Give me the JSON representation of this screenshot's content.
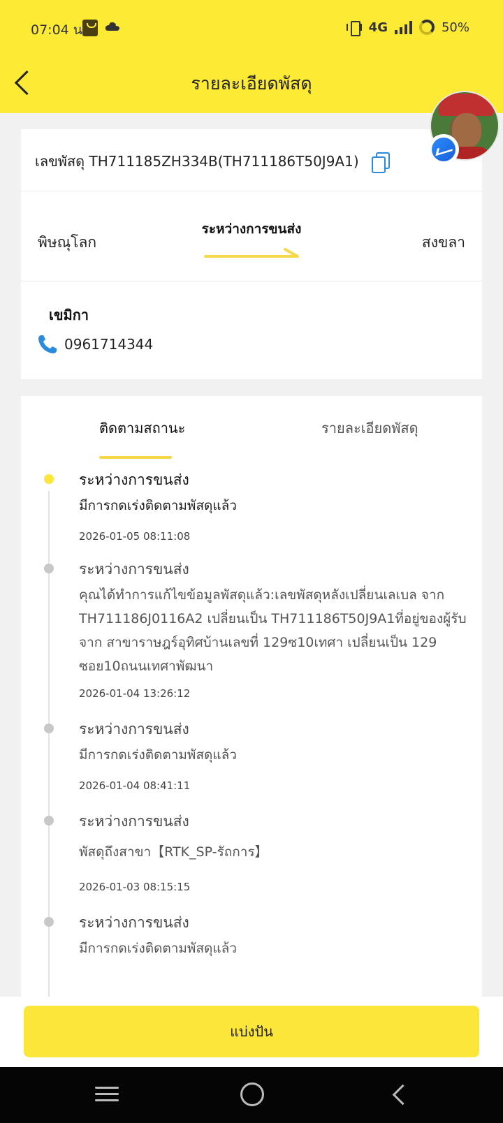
{
  "status_bar": {
    "time": "07:04 น.",
    "network": "4G",
    "battery": "50%",
    "icons": [
      "shopping-bag-icon",
      "cloud-icon",
      "vibrate-icon",
      "signal-icon",
      "battery-icon"
    ]
  },
  "header": {
    "title": "รายละเอียดพัสดุ",
    "back_icon": "chevron-left-icon",
    "background": "#fdea34"
  },
  "parcel": {
    "number_label": "เลขพัสดุ TH711185ZH334B(TH711186T50J9A1)",
    "copy_icon": "copy-icon"
  },
  "route": {
    "origin": "พิษณุโลก",
    "status": "ระหว่างการขนส่ง",
    "destination": "สงขลา"
  },
  "recipient": {
    "name": "เขมิกา",
    "phone": "0961714344",
    "phone_icon": "phone-icon"
  },
  "tabs": [
    {
      "label": "ติดตามสถานะ",
      "active": true
    },
    {
      "label": "รายละเอียดพัสดุ",
      "active": false
    }
  ],
  "timeline": [
    {
      "status": "ระหว่างการขนส่ง",
      "description": "มีการกดเร่งติดตามพัสดุแล้ว",
      "time": "2026-01-05 08:11:08",
      "active": true
    },
    {
      "status": "ระหว่างการขนส่ง",
      "description": "คุณได้ทำการแก้ไขข้อมูลพัสดุแล้ว:เลขพัสดุหลังเปลี่ยนเลเบล จาก TH711186J0116A2 เปลี่ยนเป็น TH711186T50J9A1ที่อยู่ของผู้รับ จาก สาขาราษฎร์อุทิศบ้านเลขที่ 129ซ10เทศา เปลี่ยนเป็น 129 ซอย10ถนนเทศาพัฒนา",
      "time": "2026-01-04 13:26:12",
      "active": false
    },
    {
      "status": "ระหว่างการขนส่ง",
      "description": "มีการกดเร่งติดตามพัสดุแล้ว",
      "time": "2026-01-04 08:41:11",
      "active": false
    },
    {
      "status": "ระหว่างการขนส่ง",
      "description": "พัสดุถึงสาขา【RTK_SP-รัถการ】",
      "time": "2026-01-03 08:15:15",
      "active": false
    },
    {
      "status": "ระหว่างการขนส่ง",
      "description": "มีการกดเร่งติดตามพัสดุแล้ว",
      "time": "",
      "active": false
    }
  ],
  "footer": {
    "share_label": "แบ่งปัน"
  },
  "nav_bar": {
    "icons": [
      "menu-icon",
      "home-icon",
      "back-icon"
    ]
  }
}
